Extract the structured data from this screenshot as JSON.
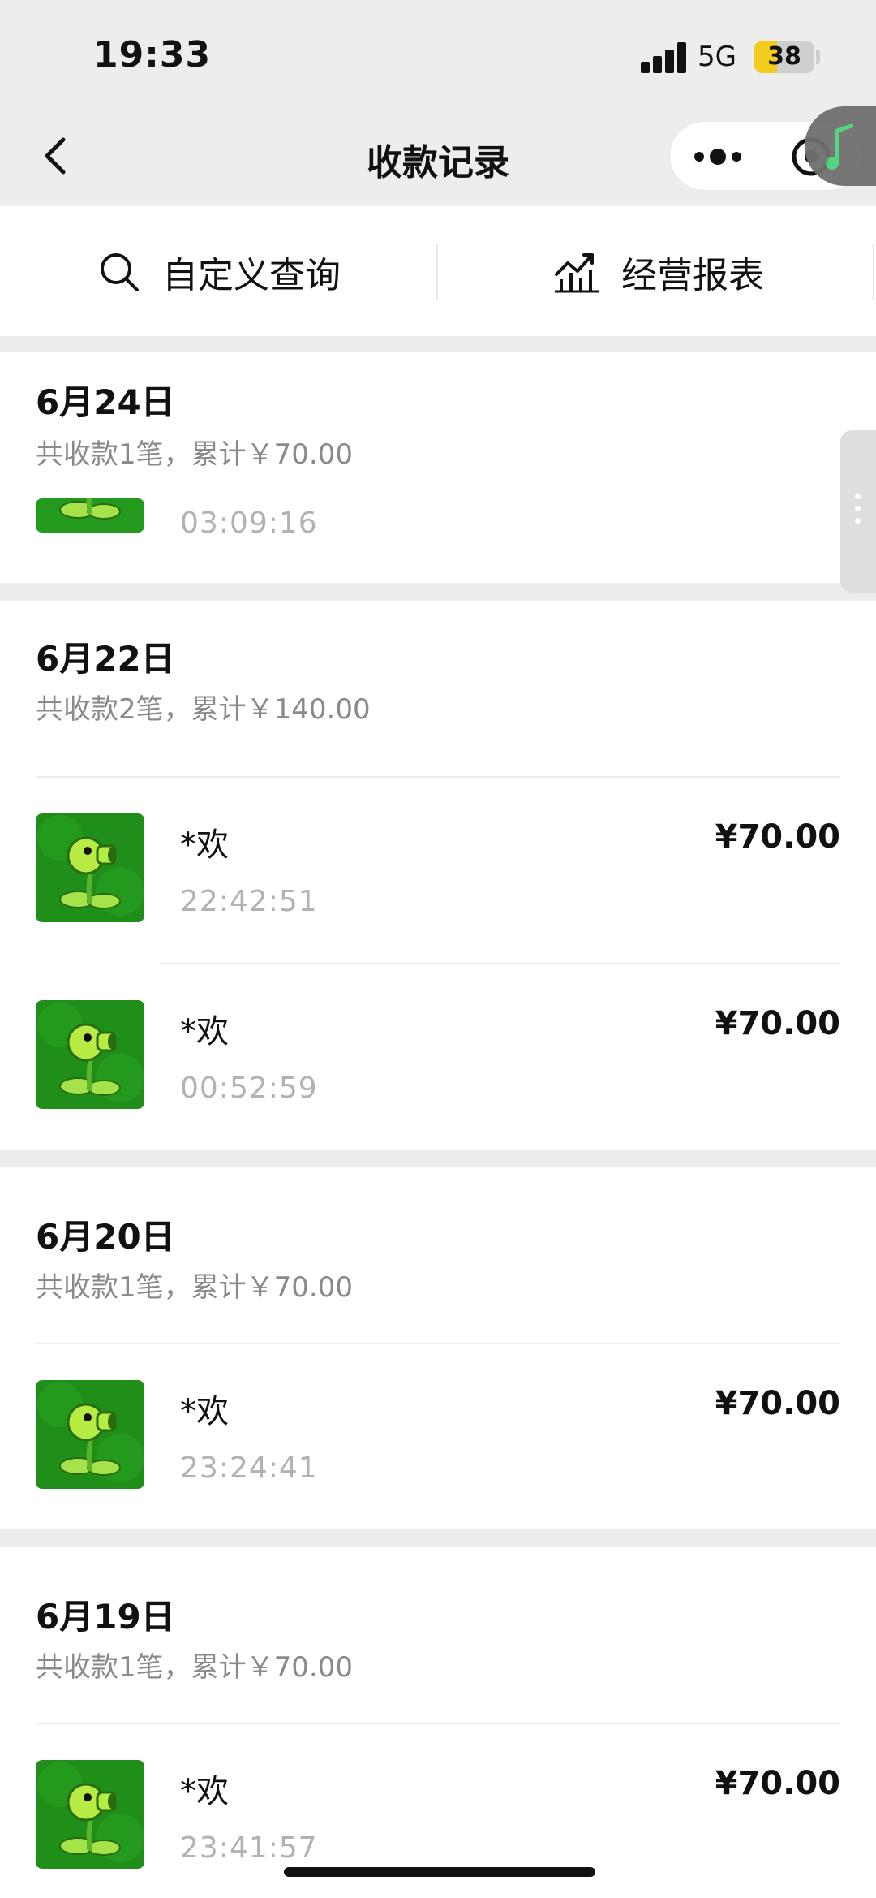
{
  "status_bar": {
    "time": "19:33",
    "network": "5G",
    "battery": "38",
    "battery_level": 0.38,
    "battery_color": "#f4cc1d"
  },
  "nav": {
    "title": "收款记录",
    "back_icon": "chevron-left-icon",
    "more_icon": "more-dots-icon",
    "close_icon": "target-circle-icon",
    "music_icon": "music-note-icon"
  },
  "toolbar": {
    "custom_query_label": "自定义查询",
    "custom_query_icon": "search-icon",
    "business_report_label": "经营报表",
    "business_report_icon": "chart-icon"
  },
  "colors": {
    "accent_green": "#1f8f1a",
    "muted_text": "#8a8a8a",
    "time_text": "#b2b2b2"
  },
  "sections": [
    {
      "date": "6月24日",
      "summary": "共收款1笔，累计￥70.00",
      "records": [
        {
          "payer": "",
          "time": "03:09:16",
          "amount": ""
        }
      ]
    },
    {
      "date": "6月22日",
      "summary": "共收款2笔，累计￥140.00",
      "records": [
        {
          "payer": "*欢",
          "time": "22:42:51",
          "amount": "¥70.00"
        },
        {
          "payer": "*欢",
          "time": "00:52:59",
          "amount": "¥70.00"
        }
      ]
    },
    {
      "date": "6月20日",
      "summary": "共收款1笔，累计￥70.00",
      "records": [
        {
          "payer": "*欢",
          "time": "23:24:41",
          "amount": "¥70.00"
        }
      ]
    },
    {
      "date": "6月19日",
      "summary": "共收款1笔，累计￥70.00",
      "records": [
        {
          "payer": "*欢",
          "time": "23:41:57",
          "amount": "¥70.00"
        }
      ]
    }
  ]
}
